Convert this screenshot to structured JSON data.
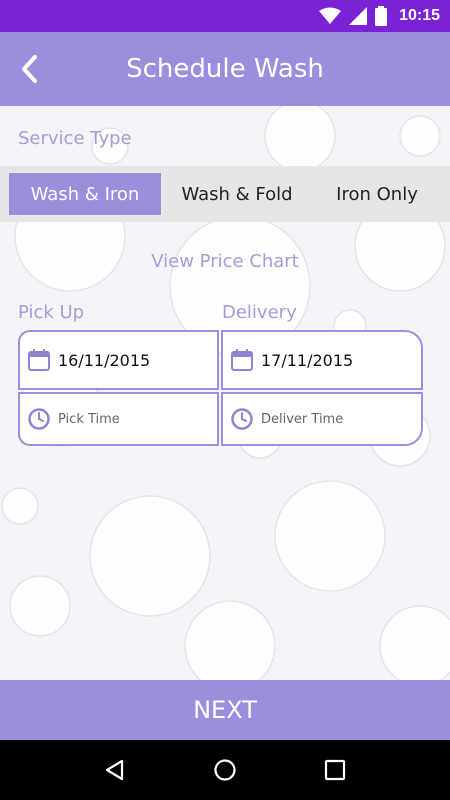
{
  "status_bar": {
    "time": "10:15",
    "icons": [
      "wifi-icon",
      "cell-signal-icon",
      "battery-icon"
    ],
    "color": "#7b22d4"
  },
  "app_bar": {
    "title": "Schedule Wash",
    "back_icon": "chevron-left-icon",
    "color": "#9b8edc"
  },
  "service": {
    "label": "Service Type",
    "tabs": [
      {
        "label": "Wash & Iron",
        "selected": true
      },
      {
        "label": "Wash & Fold",
        "selected": false
      },
      {
        "label": "Iron Only",
        "selected": false
      }
    ]
  },
  "price_chart_link": "View Price Chart",
  "pickup": {
    "label": "Pick Up",
    "date": "16/11/2015",
    "time_placeholder": "Pick Time"
  },
  "delivery": {
    "label": "Delivery",
    "date": "17/11/2015",
    "time_placeholder": "Deliver Time"
  },
  "next_button": "NEXT",
  "nav_bar": {
    "icons": [
      "back-triangle-icon",
      "home-circle-icon",
      "recents-square-icon"
    ]
  },
  "colors": {
    "accent": "#9b8edc",
    "label_text": "#a59dd6",
    "tab_strip": "#e6e6e6"
  }
}
